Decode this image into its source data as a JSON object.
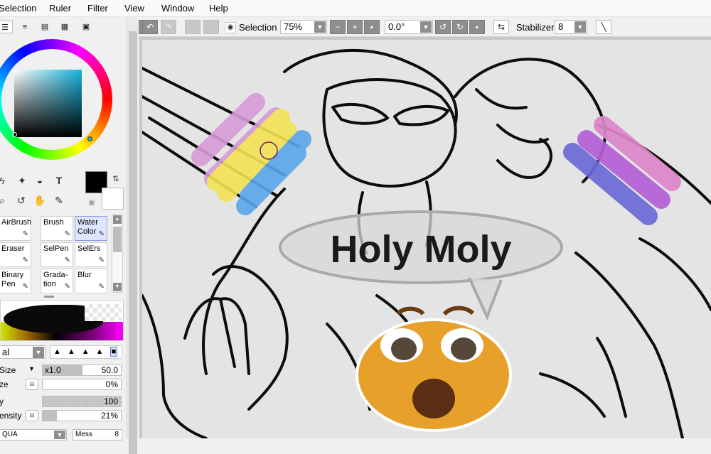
{
  "menu": [
    "Selection",
    "Ruler",
    "Filter",
    "View",
    "Window",
    "Help"
  ],
  "toolbar": {
    "selection_label": "Selection",
    "zoom": "75%",
    "rotation": "0.0°",
    "stabilizer_label": "Stabilizer",
    "stabilizer_value": "8"
  },
  "brushes": [
    {
      "label": "AirBrush",
      "icon": "airbrush-icon"
    },
    {
      "label": "Brush",
      "icon": "brush-icon"
    },
    {
      "label": "Water Color",
      "icon": "watercolor-icon",
      "selected": true
    },
    {
      "label": "Eraser",
      "icon": "eraser-icon"
    },
    {
      "label": "SelPen",
      "icon": "selpen-icon"
    },
    {
      "label": "SelErs",
      "icon": "selers-icon"
    },
    {
      "label": "Binary Pen",
      "icon": "binary-pen-icon"
    },
    {
      "label": "Grada-tion",
      "icon": "gradation-icon"
    },
    {
      "label": "Blur",
      "icon": "blur-icon"
    }
  ],
  "brush_props": {
    "blend_mode": "al",
    "size_label": "Size",
    "size_multiplier": "x1.0",
    "size_value": "50.0",
    "min_size_label": "ze",
    "min_size_value": "0%",
    "density_label": "y",
    "density_value": "100",
    "min_density_label": "ensity",
    "min_density_value": "21%",
    "mixing_label": "QUA",
    "mess_label": "Mess",
    "mess_value": "8"
  },
  "canvas": {
    "caption": "Holy Moly",
    "flag_left_colors": [
      "#d79ad6",
      "#f3e253",
      "#5aa6ea"
    ],
    "flag_right_colors": [
      "#dd86c9",
      "#b45fd7",
      "#6a6ad8"
    ]
  },
  "colors": {
    "foreground": "#000000",
    "background": "#ffffff"
  }
}
